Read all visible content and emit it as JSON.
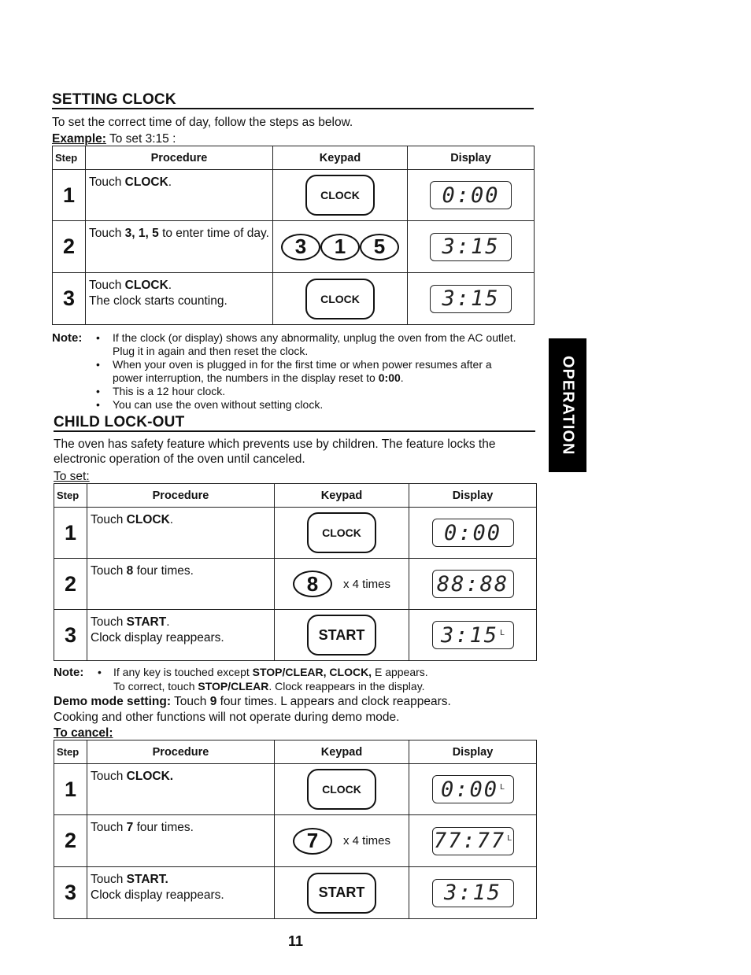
{
  "side_tab": {
    "label": "OPERATION"
  },
  "setting_clock": {
    "title": "SETTING CLOCK",
    "intro": "To set the correct time of day, follow the steps as below.",
    "example_label": "Example:",
    "example_text": " To set 3:15 :",
    "headers": {
      "step": "Step",
      "procedure": "Procedure",
      "keypad": "Keypad",
      "display": "Display"
    },
    "rows": [
      {
        "step": "1",
        "proc_pre": "Touch ",
        "proc_bold": "CLOCK",
        "proc_post": ".",
        "proc_line2": "",
        "key": "CLOCK",
        "display": "0:00",
        "display_sup": ""
      },
      {
        "step": "2",
        "proc_pre": "Touch ",
        "proc_bold": "3, 1, 5",
        "proc_post": " to enter time of day.",
        "proc_line2": "",
        "keys": [
          "3",
          "1",
          "5"
        ],
        "display": "3:15",
        "display_sup": ""
      },
      {
        "step": "3",
        "proc_pre": "Touch ",
        "proc_bold": "CLOCK",
        "proc_post": ".",
        "proc_line2": "The clock starts counting.",
        "key": "CLOCK",
        "display": "3:15",
        "display_sup": ""
      }
    ],
    "note_label": "Note:",
    "notes": [
      "If the clock (or display) shows any abnormality, unplug the oven from the AC outlet. Plug it in again and then reset the clock.",
      "When your oven is plugged in for the first time or when power resumes after a power interruption, the numbers in the display reset to ",
      "This is a 12 hour clock.",
      "You can use the oven without setting clock."
    ],
    "note2_bold": "0:00",
    "note2_post": "."
  },
  "child_lock": {
    "title": "CHILD LOCK-OUT",
    "intro": "The oven has safety feature which prevents use by children. The feature locks the electronic operation of the oven until canceled.",
    "to_set_label": "To set:",
    "headers": {
      "step": "Step",
      "procedure": "Procedure",
      "keypad": "Keypad",
      "display": "Display"
    },
    "set_rows": [
      {
        "step": "1",
        "proc_pre": "Touch ",
        "proc_bold": "CLOCK",
        "proc_post": ".",
        "proc_line2": "",
        "key": "CLOCK",
        "display": "0:00",
        "display_sup": ""
      },
      {
        "step": "2",
        "proc_pre": "Touch ",
        "proc_bold": "8",
        "proc_post": " four times.",
        "proc_line2": "",
        "key": "8",
        "times": "x 4 times",
        "display": "88:88",
        "display_sup": ""
      },
      {
        "step": "3",
        "proc_pre": "Touch ",
        "proc_bold": "START",
        "proc_post": ".",
        "proc_line2": "Clock display reappears.",
        "key": "START",
        "display": "3:15",
        "display_sup": "L"
      }
    ],
    "note_label": "Note:",
    "note_line1_pre": "If any key is touched except ",
    "note_line1_bold": "STOP/CLEAR, CLOCK,",
    "note_line1_post": " E appears.",
    "note_line2_pre": "To correct, touch ",
    "note_line2_bold": "STOP/CLEAR",
    "note_line2_post": ". Clock reappears in the display.",
    "demo_label": "Demo mode setting:",
    "demo_pre": " Touch ",
    "demo_bold": "9",
    "demo_post": " four times. L appears and clock reappears.",
    "demo_line2": "Cooking and other functions will not operate during demo mode.",
    "to_cancel_label": "To cancel:",
    "cancel_rows": [
      {
        "step": "1",
        "proc_pre": "Touch ",
        "proc_bold": "CLOCK.",
        "proc_post": "",
        "proc_line2": "",
        "key": "CLOCK",
        "display": "0:00",
        "display_sup": "L"
      },
      {
        "step": "2",
        "proc_pre": "Touch ",
        "proc_bold": "7",
        "proc_post": " four times.",
        "proc_line2": "",
        "key": "7",
        "times": "x 4 times",
        "display": "77:77",
        "display_sup": "L"
      },
      {
        "step": "3",
        "proc_pre": "Touch ",
        "proc_bold": "START.",
        "proc_post": "",
        "proc_line2": "Clock display reappears.",
        "key": "START",
        "display": "3:15",
        "display_sup": ""
      }
    ]
  },
  "page_number": "11"
}
